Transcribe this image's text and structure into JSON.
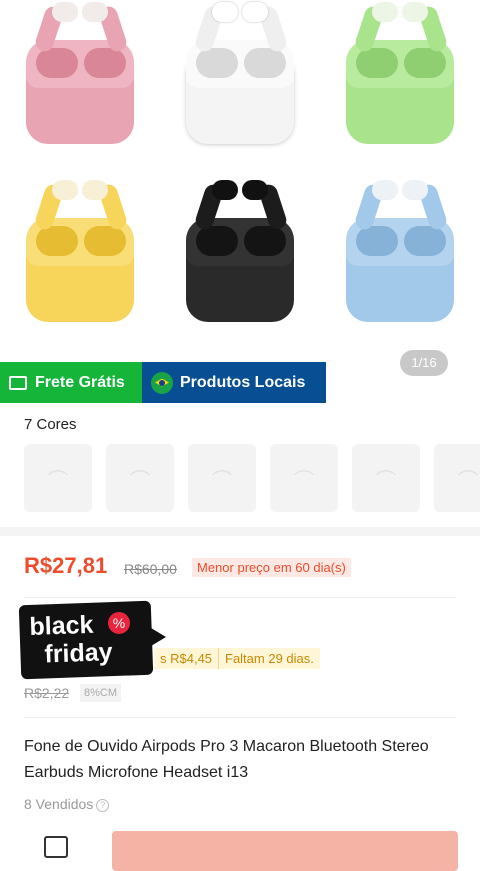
{
  "gallery": {
    "counter": "1/16",
    "colors": [
      {
        "name": "pink",
        "case": "#e9a4b3",
        "dark": "#d98798",
        "tip": "#f1ebe9"
      },
      {
        "name": "white",
        "case": "#f4f4f4",
        "dark": "#d9d9d9",
        "tip": "#ffffff"
      },
      {
        "name": "green",
        "case": "#a9e48c",
        "dark": "#8fcf71",
        "tip": "#edf6e6"
      },
      {
        "name": "yellow",
        "case": "#f7d55a",
        "dark": "#e6bd32",
        "tip": "#f8f0d6"
      },
      {
        "name": "black",
        "case": "#2a2a2a",
        "dark": "#141414",
        "tip": "#111111"
      },
      {
        "name": "blue",
        "case": "#a3c9ea",
        "dark": "#87b2d8",
        "tip": "#edf2f7"
      }
    ]
  },
  "badges": {
    "frete": "Frete Grátis",
    "local": "Produtos Locais"
  },
  "variants": {
    "label": "7 Cores"
  },
  "pricing": {
    "price": "R$27,81",
    "old_price": "R$60,00",
    "lowest_tag": "Menor preço em 60 dia(s)",
    "black_friday_line1": "black",
    "black_friday_line2": "friday",
    "bf_percent": "%",
    "coupon": "s R$4,45",
    "faltam": "Faltam 29 dias.",
    "small_old": "R$2,22",
    "small_tag": "8%CM"
  },
  "product": {
    "title": "Fone de Ouvido Airpods Pro 3 Macaron Bluetooth Stereo Earbuds Microfone Headset i13",
    "sold": "8 Vendidos",
    "info": "?"
  },
  "theme": {
    "accent": "#ee4d2d",
    "green": "#15b53a",
    "blue": "#074e93"
  }
}
